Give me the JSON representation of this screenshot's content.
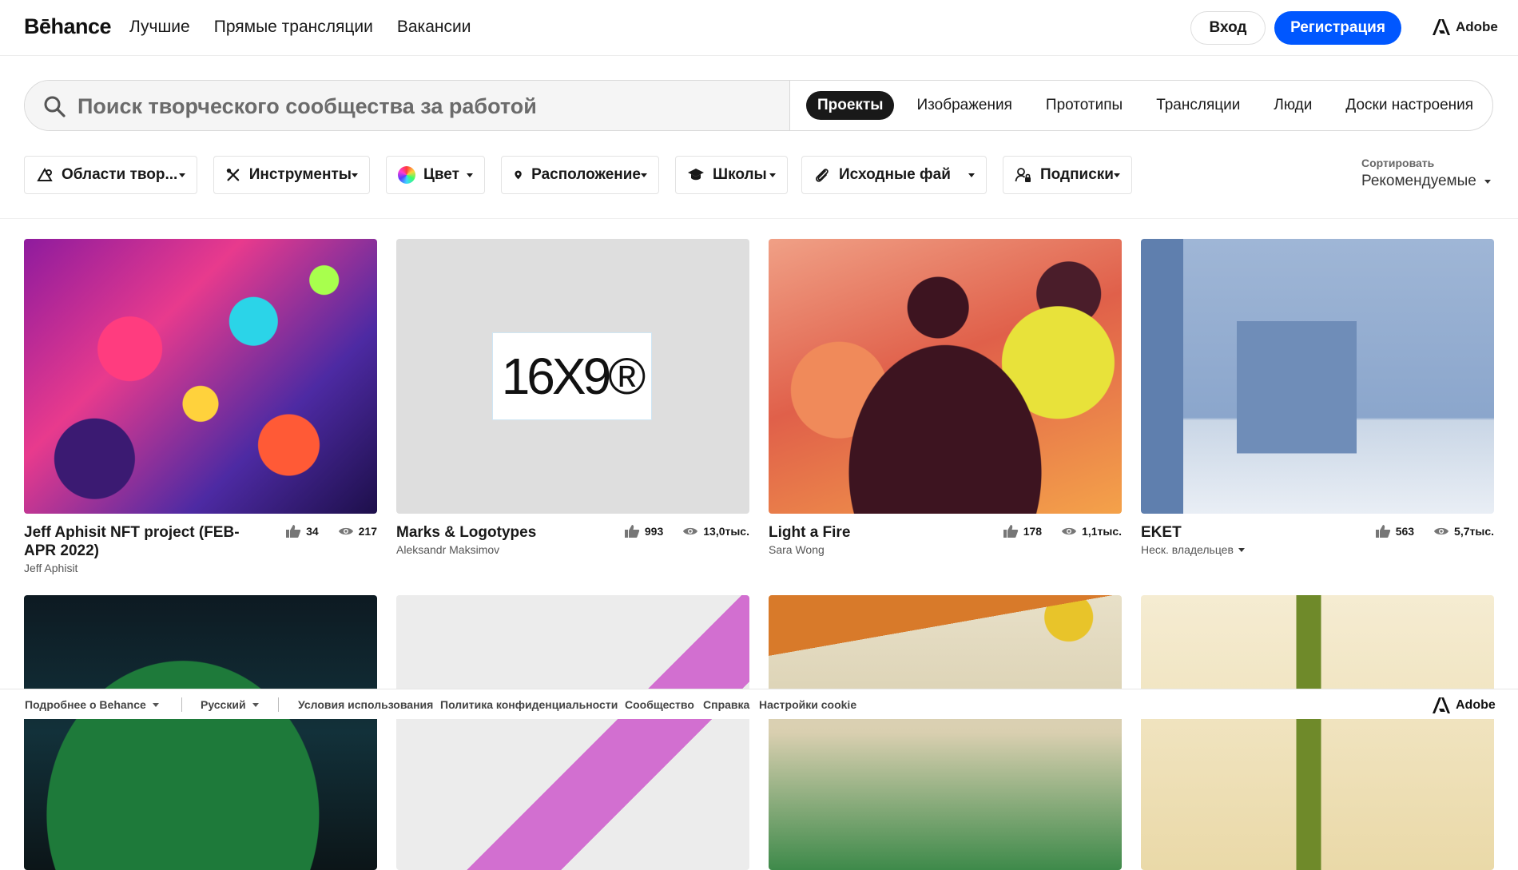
{
  "brand": {
    "logo_text": "Bēhance",
    "adobe_label": "Adobe"
  },
  "nav": {
    "links": [
      "Лучшие",
      "Прямые трансляции",
      "Вакансии"
    ]
  },
  "auth": {
    "login_label": "Вход",
    "signup_label": "Регистрация",
    "signup_color": "#0057ff"
  },
  "search": {
    "placeholder": "Поиск творческого сообщества за работой",
    "tabs": [
      "Проекты",
      "Изображения",
      "Прототипы",
      "Трансляции",
      "Люди",
      "Доски настроения"
    ],
    "active_tab": "Проекты"
  },
  "filters": [
    {
      "label": "Области твор...",
      "icon": "creative-fields-icon"
    },
    {
      "label": "Инструменты",
      "icon": "tools-icon"
    },
    {
      "label": "Цвет",
      "icon": "color-wheel-icon"
    },
    {
      "label": "Расположение",
      "icon": "location-pin-icon"
    },
    {
      "label": "Школы",
      "icon": "graduation-cap-icon"
    },
    {
      "label": "Исходные фай",
      "icon": "paperclip-icon"
    },
    {
      "label": "Подписки",
      "icon": "subscriptions-icon"
    }
  ],
  "sort": {
    "label": "Сортировать",
    "value": "Рекомендуемые"
  },
  "projects": [
    {
      "title": "Jeff Aphisit NFT project (FEB-APR 2022)",
      "owner": "Jeff Aphisit",
      "likes": "34",
      "views": "217"
    },
    {
      "title": "Marks & Logotypes",
      "owner": "Aleksandr Maksimov",
      "likes": "993",
      "views": "13,0тыс.",
      "thumb_text": "16X9®"
    },
    {
      "title": "Light a Fire",
      "owner": "Sara Wong",
      "likes": "178",
      "views": "1,1тыс."
    },
    {
      "title": "EKET",
      "owner": "Неск. владельцев",
      "likes": "563",
      "views": "5,7тыс."
    }
  ],
  "footer": {
    "about": "Подробнее о Behance",
    "language": "Русский",
    "links": [
      "Условия использования",
      "Политика конфиденциальности",
      "Сообщество",
      "Справка",
      "Настройки cookie"
    ],
    "adobe_label": "Adobe"
  }
}
